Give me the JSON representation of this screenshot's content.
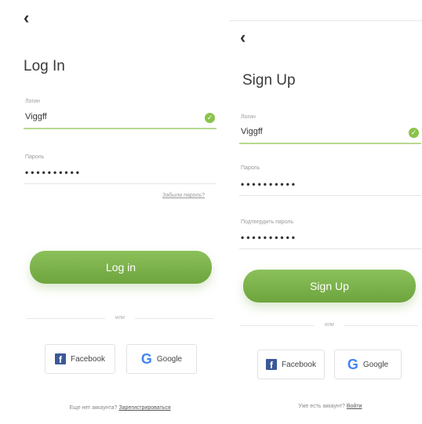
{
  "login": {
    "back_icon": "chevron-left-icon",
    "title": "Log In",
    "login_label": "Логин",
    "login_value": "Viggff",
    "password_label": "Пароль",
    "password_value": "••••••••••",
    "forgot_link": "Забыли пароль?",
    "submit_label": "Log in",
    "or_text": "или",
    "facebook_label": "Facebook",
    "google_label": "Google",
    "footer_text": "Еще нет аккаунта?",
    "footer_link": "Зарегистрироваться"
  },
  "signup": {
    "back_icon": "chevron-left-icon",
    "title": "Sign Up",
    "login_label": "Логин",
    "login_value": "Viggff",
    "password_label": "Пароль",
    "password_value": "••••••••••",
    "confirm_label": "Подтвердить пароль",
    "confirm_value": "••••••••••",
    "submit_label": "Sign Up",
    "or_text": "или",
    "facebook_label": "Facebook",
    "google_label": "Google",
    "footer_text": "Уже есть аккаунт?",
    "footer_link": "Войти"
  },
  "colors": {
    "accent": "#7cb84a",
    "check": "#8bc34a",
    "facebook": "#3b5998",
    "google": "#4285f4"
  }
}
